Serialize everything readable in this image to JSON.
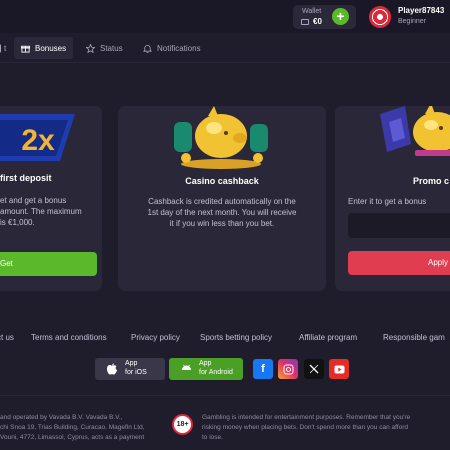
{
  "header": {
    "wallet_label": "Wallet",
    "wallet_amount": "€0",
    "add_label": "+",
    "player_name": "Player87843",
    "player_level": "Beginner"
  },
  "tabs": {
    "bonuses": "Bonuses",
    "status": "Status",
    "notifications": "Notifications"
  },
  "cards": {
    "first_deposit": {
      "badge": "2x",
      "title": "first deposit",
      "text_lines": [
        "et and get a bonus",
        "amount. The maximum",
        "is €1,000."
      ],
      "button": "Get"
    },
    "cashback": {
      "title": "Casino cashback",
      "text_lines": [
        "Cashback is credited automatically on the",
        "1st day of the next month. You will receive",
        "it if you win less than you bet."
      ]
    },
    "promo": {
      "title": "Promo c",
      "text": "Enter it to get a bonus",
      "input_value": "",
      "button": "Apply"
    }
  },
  "footer": {
    "links": [
      "ct us",
      "Terms and conditions",
      "Privacy policy",
      "Sports betting policy",
      "Affiliate program",
      "Responsible gam"
    ],
    "ios": {
      "line1": "App",
      "line2": "for iOS"
    },
    "android": {
      "line1": "App",
      "line2": "for Android"
    },
    "social": [
      "facebook-icon",
      "instagram-icon",
      "x-icon",
      "youtube-icon"
    ],
    "age_badge": "18+",
    "legal_lines": [
      "and operated by Vavada B.V. Vavada B.V.,",
      "chi Snoa 19, Trias Building, Curacao. Magefin Ltd,",
      "Vouni, 4772, Limassol, Cyprus, acts as a payment"
    ],
    "gamble_lines": [
      "Gambling is intended for entertainment purposes. Remember that you're",
      "risking money when placing bets. Don't spend more than you can afford",
      "to lose."
    ]
  },
  "colors": {
    "background": "#1f1d2b",
    "card": "#2a2838",
    "green": "#5cb82b",
    "red": "#e13d50"
  }
}
